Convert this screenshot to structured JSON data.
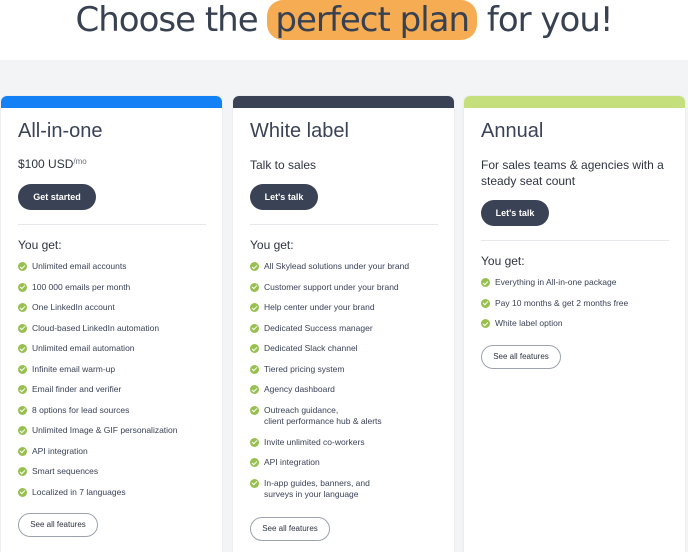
{
  "headline": {
    "before": "Choose the ",
    "highlight": "perfect plan",
    "after": " for you!"
  },
  "colors": {
    "all_in_one_bar": "#1381f5",
    "white_label_bar": "#3a4256",
    "annual_bar": "#c5df7c",
    "highlight": "#f5ac52",
    "check": "#97c04f",
    "button_dark": "#3a4256"
  },
  "plans": [
    {
      "name": "All-in-one",
      "price": "$100 USD",
      "price_unit": "/mo",
      "cta": "Get started",
      "you_get": "You get:",
      "features": [
        "Unlimited email accounts",
        "100 000 emails per month",
        "One LinkedIn account",
        "Cloud-based LinkedIn automation",
        "Unlimited email automation",
        "Infinite email warm-up",
        "Email finder and verifier",
        "8 options for lead sources",
        "Unlimited Image & GIF personalization",
        "API integration",
        "Smart sequences",
        "Localized in 7 languages"
      ],
      "see_all": "See all features"
    },
    {
      "name": "White label",
      "subtitle": "Talk to sales",
      "cta": "Let's talk",
      "you_get": "You get:",
      "features": [
        "All Skylead solutions under your brand",
        "Customer support under your brand",
        "Help center under your brand",
        "Dedicated Success manager",
        "Dedicated Slack channel",
        "Tiered pricing system",
        "Agency dashboard",
        "Outreach guidance,\nclient performance hub & alerts",
        "Invite unlimited co-workers",
        "API integration",
        "In-app guides, banners, and\nsurveys in your language"
      ],
      "see_all": "See all features"
    },
    {
      "name": "Annual",
      "subtitle": "For sales teams & agencies with a steady seat count",
      "cta": "Let's talk",
      "you_get": "You get:",
      "features": [
        "Everything in All-in-one package",
        "Pay 10 months & get 2 months free",
        "White label option"
      ],
      "see_all": "See all features"
    }
  ]
}
